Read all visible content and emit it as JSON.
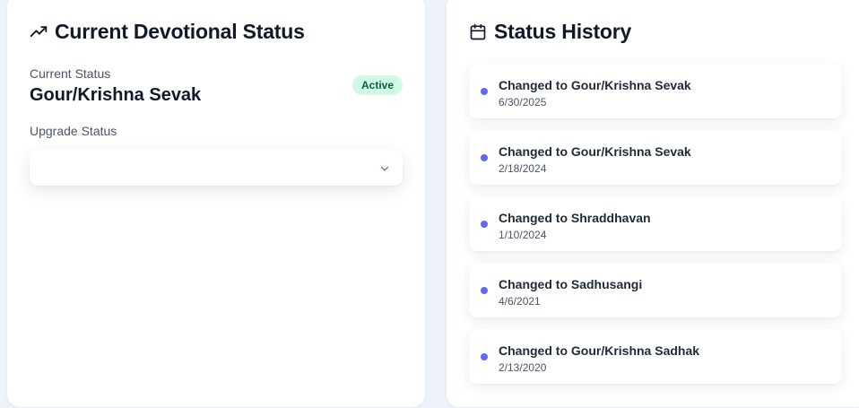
{
  "current_panel": {
    "title": "Current Devotional Status",
    "icon": "trending-up-icon",
    "current_status_label": "Current Status",
    "current_status_value": "Gour/Krishna Sevak",
    "badge": "Active",
    "badge_color": "#d1fae5",
    "upgrade_label": "Upgrade Status",
    "upgrade_select_value": ""
  },
  "history_panel": {
    "title": "Status History",
    "icon": "calendar-icon",
    "dot_color": "#6366f1",
    "items": [
      {
        "title": "Changed to Gour/Krishna Sevak",
        "date": "6/30/2025"
      },
      {
        "title": "Changed to Gour/Krishna Sevak",
        "date": "2/18/2024"
      },
      {
        "title": "Changed to Shraddhavan",
        "date": "1/10/2024"
      },
      {
        "title": "Changed to Sadhusangi",
        "date": "4/6/2021"
      },
      {
        "title": "Changed to Gour/Krishna Sadhak",
        "date": "2/13/2020"
      }
    ]
  }
}
